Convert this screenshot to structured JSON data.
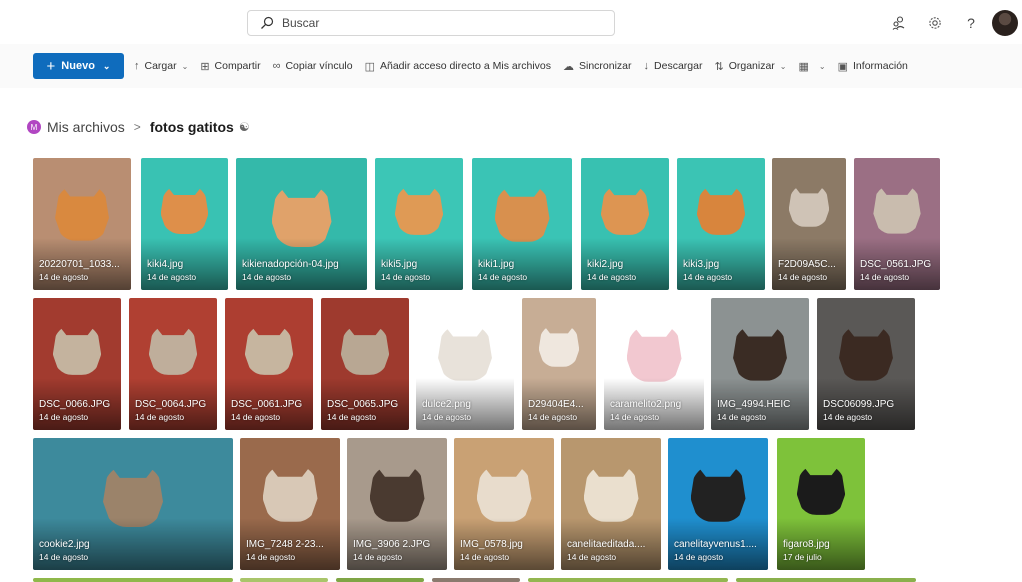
{
  "search": {
    "placeholder": "Buscar"
  },
  "header_icons": [
    "people-icon",
    "settings-icon",
    "help-icon",
    "avatar"
  ],
  "help_label": "?",
  "toolbar": {
    "new_label": "Nuevo",
    "upload_label": "Cargar",
    "share_label": "Compartir",
    "copy_link_label": "Copiar vínculo",
    "shortcut_label": "Añadir acceso directo a Mis archivos",
    "sync_label": "Sincronizar",
    "download_label": "Descargar",
    "sort_label": "Organizar",
    "info_label": "Información"
  },
  "breadcrumb": {
    "badge": "M",
    "root": "Mis archivos",
    "separator": ">",
    "current": "fotos gatitos"
  },
  "files": [
    {
      "name": "20220701_1033...",
      "date": "14 de agosto",
      "bg": "#b98e72",
      "cat": "#d9893f"
    },
    {
      "name": "kiki4.jpg",
      "date": "14 de agosto",
      "bg": "#39c2b3",
      "cat": "#de8f4a"
    },
    {
      "name": "kikienadopción-04.jpg",
      "date": "14 de agosto",
      "bg": "#34b9aa",
      "cat": "#e0a26a"
    },
    {
      "name": "kiki5.jpg",
      "date": "14 de agosto",
      "bg": "#3cc6b6",
      "cat": "#df9a55"
    },
    {
      "name": "kiki1.jpg",
      "date": "14 de agosto",
      "bg": "#3ac4b5",
      "cat": "#d8904e"
    },
    {
      "name": "kiki2.jpg",
      "date": "14 de agosto",
      "bg": "#38c1b1",
      "cat": "#dd9552"
    },
    {
      "name": "kiki3.jpg",
      "date": "14 de agosto",
      "bg": "#3bc4b4",
      "cat": "#d8853d"
    },
    {
      "name": "F2D09A5C...",
      "date": "14 de agosto",
      "bg": "#8c7a66",
      "cat": "#cfc3b6"
    },
    {
      "name": "DSC_0561.JPG",
      "date": "14 de agosto",
      "bg": "#9b6f84",
      "cat": "#c9bcae"
    },
    {
      "name": "DSC_0066.JPG",
      "date": "14 de agosto",
      "bg": "#a23b2f",
      "cat": "#c4b39e"
    },
    {
      "name": "DSC_0064.JPG",
      "date": "14 de agosto",
      "bg": "#b04032",
      "cat": "#bfae9b"
    },
    {
      "name": "DSC_0061.JPG",
      "date": "14 de agosto",
      "bg": "#ad3e31",
      "cat": "#c6b59f"
    },
    {
      "name": "DSC_0065.JPG",
      "date": "14 de agosto",
      "bg": "#9e3a2e",
      "cat": "#b8a793"
    },
    {
      "name": "dulce2.png",
      "date": "14 de agosto",
      "bg": "#ffffff",
      "cat": "#e8e2da"
    },
    {
      "name": "D29404E4...",
      "date": "14 de agosto",
      "bg": "#c7ad95",
      "cat": "#efe7de"
    },
    {
      "name": "caramelito2.png",
      "date": "14 de agosto",
      "bg": "#ffffff",
      "cat": "#f2c8d0"
    },
    {
      "name": "IMG_4994.HEIC",
      "date": "14 de agosto",
      "bg": "#8c9292",
      "cat": "#3a2c24"
    },
    {
      "name": "DSC06099.JPG",
      "date": "14 de agosto",
      "bg": "#5a5856",
      "cat": "#3b2a22"
    },
    {
      "name": "cookie2.jpg",
      "date": "14 de agosto",
      "bg": "#3d8a9c",
      "cat": "#9b836a"
    },
    {
      "name": "IMG_7248 2-23...",
      "date": "14 de agosto",
      "bg": "#9a6a4c",
      "cat": "#d8c8b6"
    },
    {
      "name": "IMG_3906 2.JPG",
      "date": "14 de agosto",
      "bg": "#a89a8c",
      "cat": "#4a3a30"
    },
    {
      "name": "IMG_0578.jpg",
      "date": "14 de agosto",
      "bg": "#c9a174",
      "cat": "#e8dccc"
    },
    {
      "name": "canelitaeditada....",
      "date": "14 de agosto",
      "bg": "#b8976e",
      "cat": "#eadfce"
    },
    {
      "name": "canelitayvenus1....",
      "date": "14 de agosto",
      "bg": "#1f8fcf",
      "cat": "#222222"
    },
    {
      "name": "figaro8.jpg",
      "date": "17 de julio",
      "bg": "#7ec23a",
      "cat": "#1b1b1b"
    }
  ],
  "next_row_colors": [
    "#8fb84a",
    "#a9c56a",
    "#7fa545",
    "#8a7a6e",
    "#93b650",
    "#8ab04c"
  ]
}
